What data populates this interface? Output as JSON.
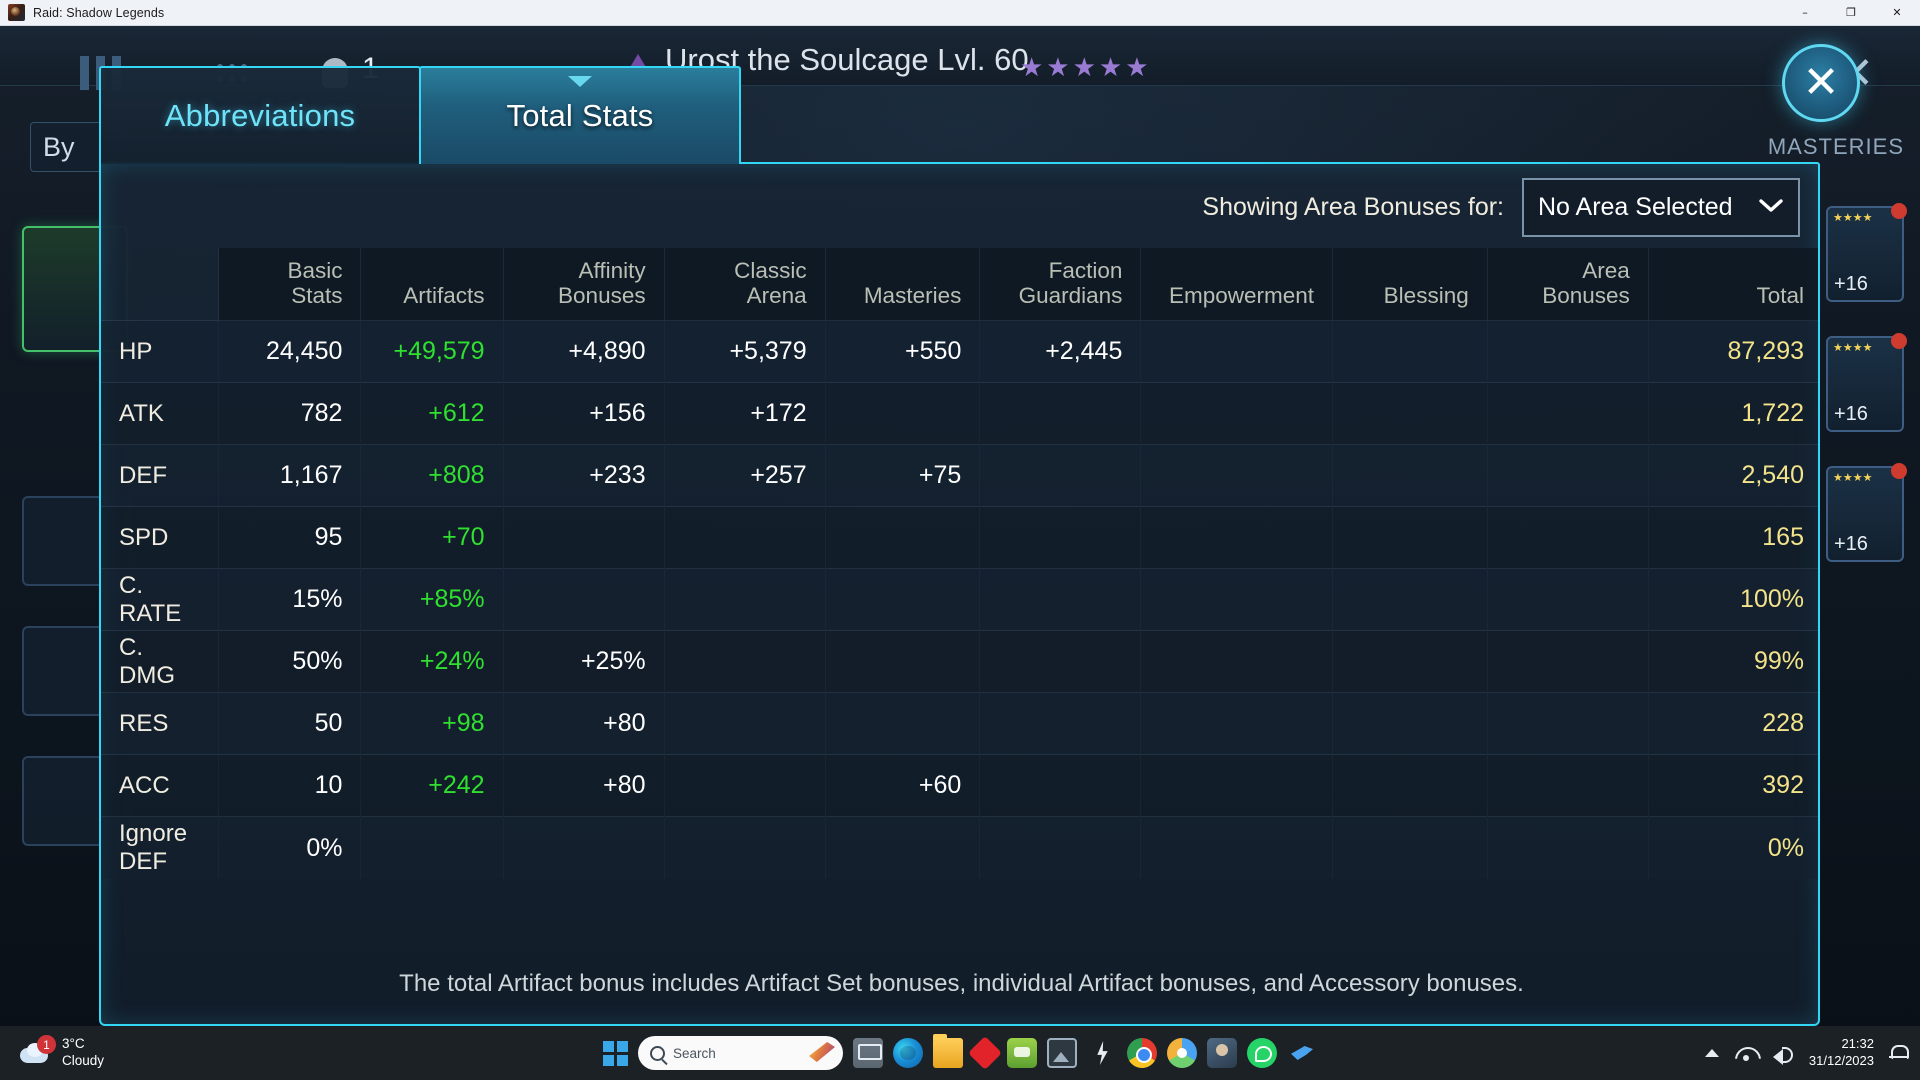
{
  "window": {
    "title": "Raid: Shadow Legends",
    "app_icon": "game-icon",
    "minimize": "–",
    "maximize": "❐",
    "close": "✕"
  },
  "game_background": {
    "champion_name": "Urost the Soulcage Lvl. 60",
    "team_count": "1",
    "by_label": "By",
    "masteries_label": "MASTERIES",
    "close_x": "✕",
    "gear_levels": [
      "+16",
      "+16",
      "+16"
    ],
    "gear_stars": "★★★★★"
  },
  "modal": {
    "tabs": [
      {
        "label": "Abbreviations",
        "active": false
      },
      {
        "label": "Total Stats",
        "active": true
      }
    ],
    "close_icon": "✕",
    "area_selector": {
      "label": "Showing Area Bonuses for:",
      "value": "No Area Selected",
      "chevron": "❯"
    },
    "footnote": "The total Artifact bonus includes Artifact Set bonuses, individual Artifact bonuses, and Accessory bonuses.",
    "accent_color": "#33d7f5",
    "artifact_color": "#2fe02f",
    "total_color": "#f3e38a"
  },
  "chart_data": {
    "type": "table",
    "title": "Total Stats",
    "columns": [
      "",
      "Basic Stats",
      "Artifacts",
      "Affinity Bonuses",
      "Classic Arena",
      "Masteries",
      "Faction Guardians",
      "Empowerment",
      "Blessing",
      "Area Bonuses",
      "Total"
    ],
    "rows": [
      {
        "stat": "HP",
        "basic": "24,450",
        "artifacts": "+49,579",
        "affinity": "+4,890",
        "arena": "+5,379",
        "masteries": "+550",
        "faction": "+2,445",
        "empowerment": "",
        "blessing": "",
        "area": "",
        "total": "87,293"
      },
      {
        "stat": "ATK",
        "basic": "782",
        "artifacts": "+612",
        "affinity": "+156",
        "arena": "+172",
        "masteries": "",
        "faction": "",
        "empowerment": "",
        "blessing": "",
        "area": "",
        "total": "1,722"
      },
      {
        "stat": "DEF",
        "basic": "1,167",
        "artifacts": "+808",
        "affinity": "+233",
        "arena": "+257",
        "masteries": "+75",
        "faction": "",
        "empowerment": "",
        "blessing": "",
        "area": "",
        "total": "2,540"
      },
      {
        "stat": "SPD",
        "basic": "95",
        "artifacts": "+70",
        "affinity": "",
        "arena": "",
        "masteries": "",
        "faction": "",
        "empowerment": "",
        "blessing": "",
        "area": "",
        "total": "165"
      },
      {
        "stat": "C. RATE",
        "basic": "15%",
        "artifacts": "+85%",
        "affinity": "",
        "arena": "",
        "masteries": "",
        "faction": "",
        "empowerment": "",
        "blessing": "",
        "area": "",
        "total": "100%"
      },
      {
        "stat": "C. DMG",
        "basic": "50%",
        "artifacts": "+24%",
        "affinity": "+25%",
        "arena": "",
        "masteries": "",
        "faction": "",
        "empowerment": "",
        "blessing": "",
        "area": "",
        "total": "99%"
      },
      {
        "stat": "RES",
        "basic": "50",
        "artifacts": "+98",
        "affinity": "+80",
        "arena": "",
        "masteries": "",
        "faction": "",
        "empowerment": "",
        "blessing": "",
        "area": "",
        "total": "228"
      },
      {
        "stat": "ACC",
        "basic": "10",
        "artifacts": "+242",
        "affinity": "+80",
        "arena": "",
        "masteries": "+60",
        "faction": "",
        "empowerment": "",
        "blessing": "",
        "area": "",
        "total": "392"
      },
      {
        "stat": "Ignore DEF",
        "basic": "0%",
        "artifacts": "",
        "affinity": "",
        "arena": "",
        "masteries": "",
        "faction": "",
        "empowerment": "",
        "blessing": "",
        "area": "",
        "total": "0%"
      }
    ]
  },
  "taskbar": {
    "weather": {
      "temperature": "3°C",
      "condition": "Cloudy",
      "badge": "1"
    },
    "search_placeholder": "Search",
    "apps": [
      "task-view",
      "edge",
      "file-explorer",
      "red-app",
      "green-app",
      "photos",
      "bolt-app",
      "chrome",
      "chrome-alt",
      "avatar-app",
      "whatsapp",
      "bird-app"
    ],
    "clock": {
      "time": "21:32",
      "date": "31/12/2023"
    }
  }
}
